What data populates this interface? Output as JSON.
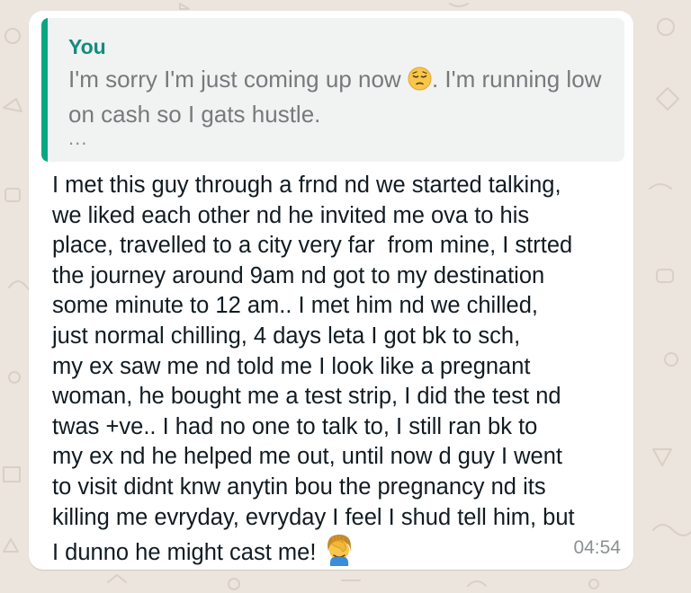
{
  "chat": {
    "quoted": {
      "author": "You",
      "text_part1": "I'm sorry I'm just coming up now ",
      "emoji": "pensive-face-icon",
      "text_part2": ". I'm running low on cash so I gats hustle.",
      "ellipsis": "..."
    },
    "message": {
      "lines": [
        "I met this guy through a frnd nd we started talking,",
        "we liked each other nd he invited me ova to his",
        "place, travelled to a city very far  from mine, I strted",
        "the journey around 9am nd got to my destination",
        "some minute to 12 am.. I met him nd we chilled,",
        "just normal chilling, 4 days leta I got bk to sch,",
        "my ex saw me nd told me I look like a pregnant",
        "woman, he bought me a test strip, I did the test nd",
        "twas +ve.. I had no one to talk to, I still ran bk to",
        "my ex nd he helped me out, until now d guy I went",
        "to visit didnt knw anytin bou the pregnancy nd its",
        "killing me evryday, evryday I feel I shud tell him, but"
      ],
      "last_line": "I dunno he might cast me!",
      "last_emoji": "facepalm-icon"
    },
    "time": "04:54"
  },
  "colors": {
    "background": "#ECE5DD",
    "bubble": "#FFFFFF",
    "quote_bg": "#F1F2F2",
    "quote_bar": "#06A884",
    "quote_author": "#128C7E",
    "quote_text": "#767A7C",
    "message_text": "#111B21",
    "timestamp": "#8C9193"
  }
}
